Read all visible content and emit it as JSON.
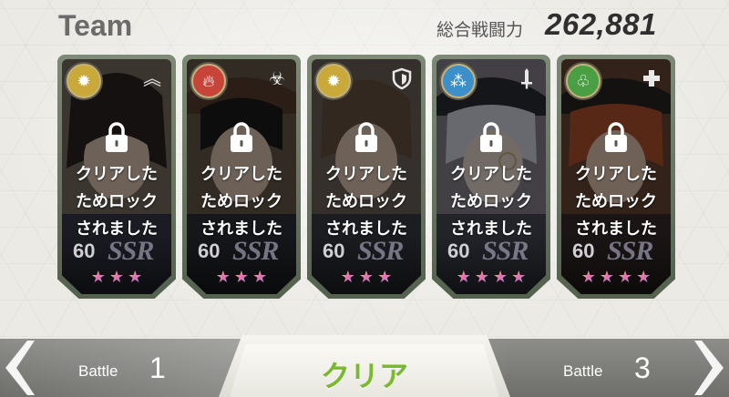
{
  "header": {
    "title": "Team",
    "power_label": "総合戦闘力",
    "power_value": "262,881"
  },
  "cards": [
    {
      "element": "light",
      "element_color": "#c9a93a",
      "role": "chevrons-up-icon",
      "lock_text": [
        "クリアした",
        "ためロック",
        "されました"
      ],
      "level": "60",
      "rarity": "SSR",
      "stars": 3,
      "portrait_tint": "#6b5a48"
    },
    {
      "element": "fire",
      "element_color": "#c7443a",
      "role": "biohazard-icon",
      "lock_text": [
        "クリアした",
        "ためロック",
        "されました"
      ],
      "level": "60",
      "rarity": "SSR",
      "stars": 3,
      "portrait_tint": "#4a3f3a"
    },
    {
      "element": "light",
      "element_color": "#c9a93a",
      "role": "shield-icon",
      "lock_text": [
        "クリアした",
        "ためロック",
        "されました"
      ],
      "level": "60",
      "rarity": "SSR",
      "stars": 3,
      "portrait_tint": "#5e5047"
    },
    {
      "element": "water",
      "element_color": "#3d8fc9",
      "role": "sword-icon",
      "lock_text": [
        "クリアした",
        "ためロック",
        "されました"
      ],
      "level": "60",
      "rarity": "SSR",
      "stars": 4,
      "portrait_tint": "#6b6870"
    },
    {
      "element": "wind",
      "element_color": "#4a9e44",
      "role": "cross-icon",
      "lock_text": [
        "クリアした",
        "ためロック",
        "されました"
      ],
      "level": "60",
      "rarity": "SSR",
      "stars": 4,
      "portrait_tint": "#6a4230"
    }
  ],
  "footer": {
    "prev_label": "Battle",
    "prev_num": "1",
    "center_label": "クリア",
    "next_label": "Battle",
    "next_num": "3"
  }
}
